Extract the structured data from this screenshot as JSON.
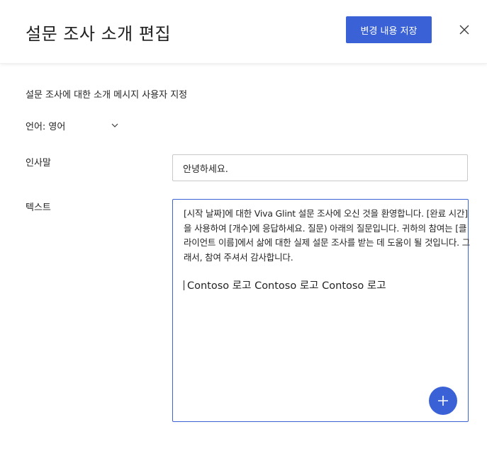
{
  "header": {
    "title": "설문 조사 소개 편집",
    "save_label": "변경 내용 저장",
    "close_icon": "close-icon"
  },
  "form": {
    "subtitle": "설문 조사에 대한 소개 메시지 사용자 지정",
    "language_label": "언어: 영어",
    "greeting_label": "인사말",
    "greeting_value": "안녕하세요.",
    "text_label": "텍스트",
    "text_body": "[시작 날짜]에 대한 Viva Glint 설문 조사에 오신 것을 환영합니다. [완료 시간]을 사용하여 [개수]에 응답하세요. 질문) 아래의 질문입니다. 귀하의 참여는 [클라이언트 이름]에서 삶에 대한 실제 설문 조사를 받는 데 도움이 될 것입니다. 그래서, 참여 주셔서 감사합니다.",
    "logo_line": "Contoso 로고 Contoso 로고 Contoso 로고"
  },
  "colors": {
    "accent": "#3a62d6",
    "text": "#242424",
    "border": "#c8c8c8"
  }
}
